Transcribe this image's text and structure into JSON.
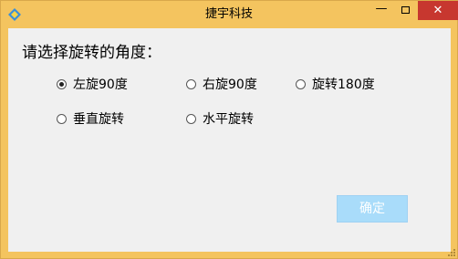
{
  "window": {
    "title": "捷宇科技",
    "minimize_glyph": "—",
    "close_glyph": "✕",
    "app_icon": "diamond-app-icon",
    "close_color": "#c7372f",
    "frame_color": "#f4c45f"
  },
  "dialog": {
    "prompt": "请选择旋转的角度：",
    "options": [
      {
        "label": "左旋90度",
        "selected": true
      },
      {
        "label": "右旋90度",
        "selected": false
      },
      {
        "label": "旋转180度",
        "selected": false
      },
      {
        "label": "垂直旋转",
        "selected": false
      },
      {
        "label": "水平旋转",
        "selected": false
      }
    ],
    "ok_label": "确定"
  }
}
